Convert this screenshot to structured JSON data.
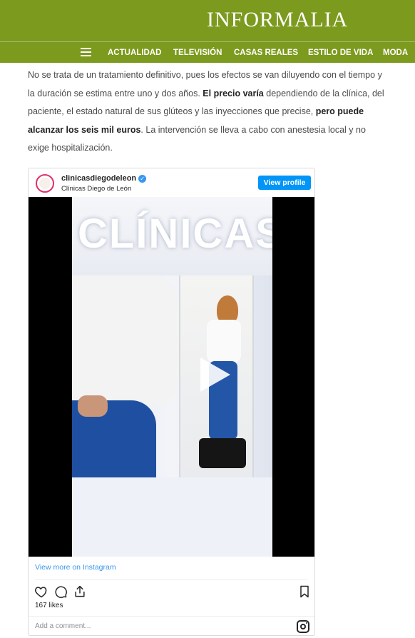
{
  "header": {
    "brand": "INFORMALIA",
    "nav": [
      "ACTUALIDAD",
      "TELEVISIÓN",
      "CASAS REALES",
      "ESTILO DE VIDA",
      "MODA"
    ]
  },
  "article": {
    "t1": "No se trata de un tratamiento definitivo, pues los efectos se van diluyendo con el tiempo y la duración se estima entre uno y dos años. ",
    "t2": "El precio varía",
    "t3": " dependiendo de la clínica, del paciente, el estado natural de sus glúteos y las inyecciones que precise, ",
    "t4": "pero puede alcanzar los seis mil euros",
    "t5": ". La intervención se lleva a cabo con anestesia local y no exige hospitalización."
  },
  "instagram": {
    "username": "clinicasdiegodeleon",
    "subtitle": "Clínicas Diego de León",
    "view_profile": "View profile",
    "video_text": "CLÍNICAS",
    "view_more": "View more on Instagram",
    "likes": "167 likes",
    "comment_placeholder": "Add a comment...",
    "colors": {
      "button": "#0095f6",
      "link": "#3897f0"
    },
    "icons": [
      "heart-icon",
      "comment-icon",
      "share-icon",
      "bookmark-icon",
      "instagram-icon",
      "play-icon",
      "verified-icon"
    ]
  },
  "theme": {
    "header_color": "#7c9a1e"
  }
}
